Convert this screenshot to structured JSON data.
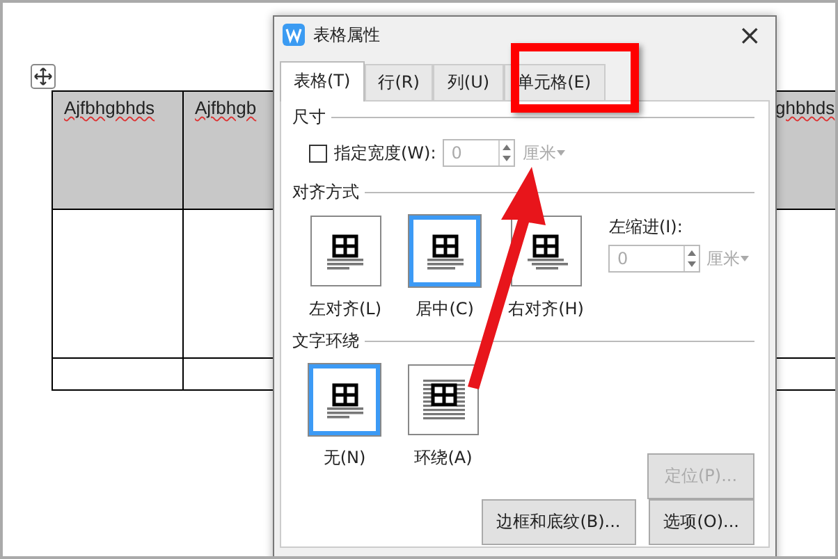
{
  "document": {
    "table_cells": [
      {
        "text": "Ajfbhgbhds"
      },
      {
        "text": "Ajfbhgb"
      },
      {
        "text": "ghbhds"
      }
    ]
  },
  "dialog": {
    "title": "表格属性",
    "close": "×",
    "tabs": [
      {
        "label": "表格(T)",
        "selected": true
      },
      {
        "label": "行(R)",
        "selected": false
      },
      {
        "label": "列(U)",
        "selected": false
      },
      {
        "label": "单元格(E)",
        "selected": false
      }
    ],
    "size": {
      "heading": "尺寸",
      "checkbox_label": "指定宽度(W):",
      "checked": false,
      "value": "0",
      "unit": "厘米",
      "disabled": true
    },
    "alignment": {
      "heading": "对齐方式",
      "options": [
        {
          "label": "左对齐(L)",
          "kind": "left",
          "selected": false
        },
        {
          "label": "居中(C)",
          "kind": "center",
          "selected": true
        },
        {
          "label": "右对齐(H)",
          "kind": "right",
          "selected": false
        }
      ],
      "indent_label": "左缩进(I):",
      "indent_value": "0",
      "indent_unit": "厘米",
      "indent_disabled": true
    },
    "wrapping": {
      "heading": "文字环绕",
      "options": [
        {
          "label": "无(N)",
          "kind": "none",
          "selected": true
        },
        {
          "label": "环绕(A)",
          "kind": "around",
          "selected": false
        }
      ]
    },
    "position_button": {
      "label": "定位(P)...",
      "disabled": true
    },
    "buttons": [
      {
        "label": "边框和底纹(B)..."
      },
      {
        "label": "选项(O)..."
      }
    ]
  }
}
